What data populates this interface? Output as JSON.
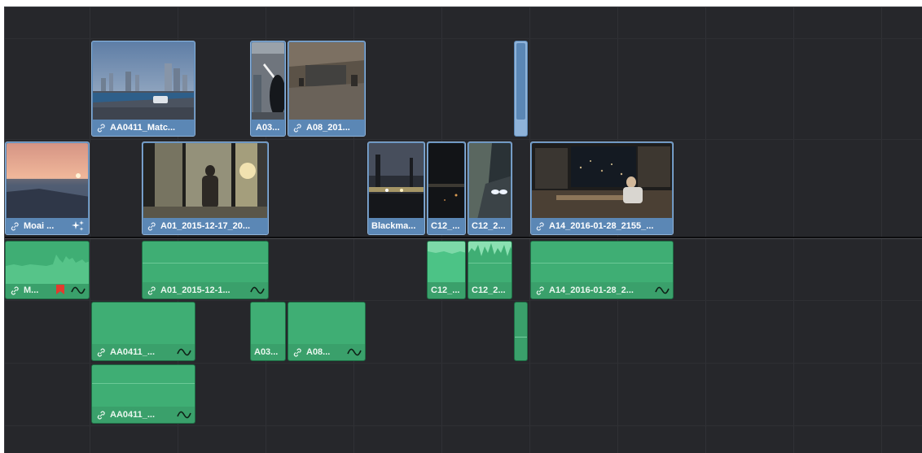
{
  "timeline": {
    "video_clips": [
      {
        "id": "v2-aa0411",
        "label": "AA0411_Matc...",
        "link": true
      },
      {
        "id": "v2-a03",
        "label": "A03...",
        "link": false
      },
      {
        "id": "v2-a08",
        "label": "A08_201...",
        "link": true
      },
      {
        "id": "v2-thin",
        "label": "",
        "link": false
      },
      {
        "id": "v1-moai",
        "label": "Moai ...",
        "link": true,
        "effect": "sparkle-icon"
      },
      {
        "id": "v1-a01",
        "label": "A01_2015-12-17_20...",
        "link": true
      },
      {
        "id": "v1-blackma",
        "label": "Blackma...",
        "link": false
      },
      {
        "id": "v1-c12a",
        "label": "C12_...",
        "link": false
      },
      {
        "id": "v1-c12b",
        "label": "C12_2...",
        "link": false
      },
      {
        "id": "v1-a14",
        "label": "A14_2016-01-28_2155_...",
        "link": true
      }
    ],
    "audio_clips": [
      {
        "id": "a1-moai",
        "label": "M...",
        "link": true,
        "flag": true
      },
      {
        "id": "a1-a01",
        "label": "A01_2015-12-1...",
        "link": true
      },
      {
        "id": "a1-c12a",
        "label": "C12_...",
        "link": false
      },
      {
        "id": "a1-c12b",
        "label": "C12_2...",
        "link": false
      },
      {
        "id": "a1-a14",
        "label": "A14_2016-01-28_2...",
        "link": true
      },
      {
        "id": "a2-aa0411",
        "label": "AA0411_...",
        "link": true
      },
      {
        "id": "a2-a03",
        "label": "A03...",
        "link": false
      },
      {
        "id": "a2-a08",
        "label": "A08...",
        "link": true
      },
      {
        "id": "a2-thin",
        "label": "",
        "link": false
      },
      {
        "id": "a3-aa0411",
        "label": "AA0411_...",
        "link": true
      }
    ],
    "colors": {
      "background": "#26272b",
      "video_clip": "#5b87b5",
      "audio_clip": "#3aa06b",
      "flag": "#e23b2e"
    }
  }
}
